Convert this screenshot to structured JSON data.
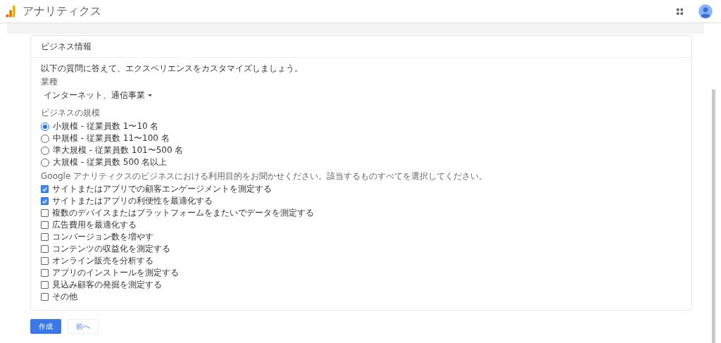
{
  "app_bar": {
    "title": "アナリティクス"
  },
  "card": {
    "title": "ビジネス情報",
    "intro": "以下の質問に答えて、エクスペリエンスをカスタマイズしましょう。",
    "industry": {
      "label": "業種",
      "value": "インターネット、通信事業"
    },
    "size": {
      "label": "ビジネスの規模",
      "options": [
        {
          "label": "小規模 - 従業員数 1〜10 名",
          "selected": true
        },
        {
          "label": "中規模 - 従業員数 11〜100 名",
          "selected": false
        },
        {
          "label": "準大規模 - 従業員数 101〜500 名",
          "selected": false
        },
        {
          "label": "大規模 - 従業員数 500 名以上",
          "selected": false
        }
      ]
    },
    "usage": {
      "label": "Google アナリティクスのビジネスにおける利用目的をお聞かせください。該当するものすべてを選択してください。",
      "options": [
        {
          "label": "サイトまたはアプリでの顧客エンゲージメントを測定する",
          "checked": true
        },
        {
          "label": "サイトまたはアプリの利便性を最適化する",
          "checked": true
        },
        {
          "label": "複数のデバイスまたはプラットフォームをまたいでデータを測定する",
          "checked": false
        },
        {
          "label": "広告費用を最適化する",
          "checked": false
        },
        {
          "label": "コンバージョン数を増やす",
          "checked": false
        },
        {
          "label": "コンテンツの収益化を測定する",
          "checked": false
        },
        {
          "label": "オンライン販売を分析する",
          "checked": false
        },
        {
          "label": "アプリのインストールを測定する",
          "checked": false
        },
        {
          "label": "見込み顧客の発掘を測定する",
          "checked": false
        },
        {
          "label": "その他",
          "checked": false
        }
      ]
    }
  },
  "buttons": {
    "create": "作成",
    "back": "前へ"
  }
}
